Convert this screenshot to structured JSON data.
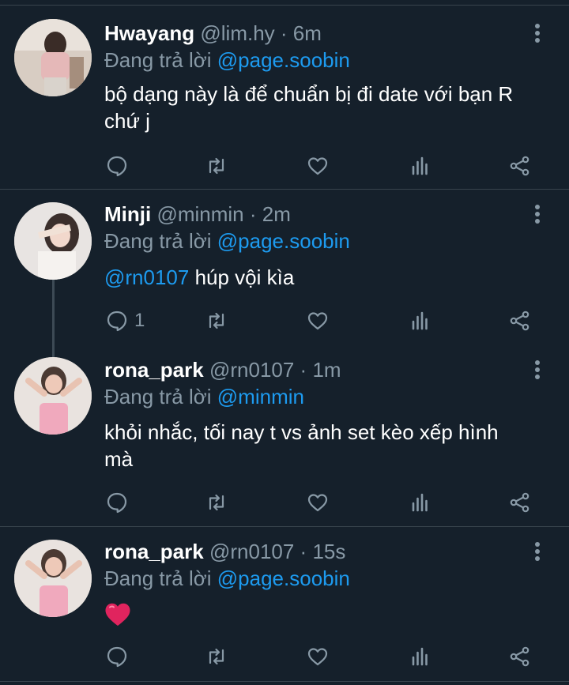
{
  "tweets": [
    {
      "name": "Hwayang",
      "handle": "@lim.hy",
      "sep": " · ",
      "time": "6m",
      "reply_prefix": "Đang trả lời ",
      "reply_to": "@page.soobin",
      "body_lines": [
        "bộ dạng này là để chuẩn bị đi date với bạn R",
        "chứ j"
      ],
      "reply_count": ""
    },
    {
      "name": "Minji",
      "handle": "@minmin",
      "sep": " · ",
      "time": "2m",
      "reply_prefix": "Đang trả lời ",
      "reply_to": "@page.soobin",
      "body_mention": "@rn0107",
      "body_text": " húp vội kìa",
      "reply_count": "1"
    },
    {
      "name": "rona_park",
      "handle": "@rn0107",
      "sep": " · ",
      "time": "1m",
      "reply_prefix": "Đang trả lời ",
      "reply_to": "@minmin",
      "body_lines": [
        "khỏi nhắc, tối nay t vs ảnh set kèo xếp hình",
        "mà"
      ],
      "reply_count": ""
    },
    {
      "name": "rona_park",
      "handle": "@rn0107",
      "sep": " · ",
      "time": "15s",
      "reply_prefix": "Đang trả lời ",
      "reply_to": "@page.soobin",
      "body_emoji": "heart-emoji",
      "reply_count": ""
    }
  ],
  "icons": {
    "reply": "comment-icon",
    "retweet": "retweet-icon",
    "like": "heart-icon",
    "analytics": "analytics-icon",
    "share": "share-icon",
    "more": "more-vertical-icon"
  },
  "colors": {
    "background": "#15202b",
    "muted": "#8899a6",
    "link": "#1d9bf0",
    "divider": "#38444d",
    "heart": "#e0245e"
  }
}
